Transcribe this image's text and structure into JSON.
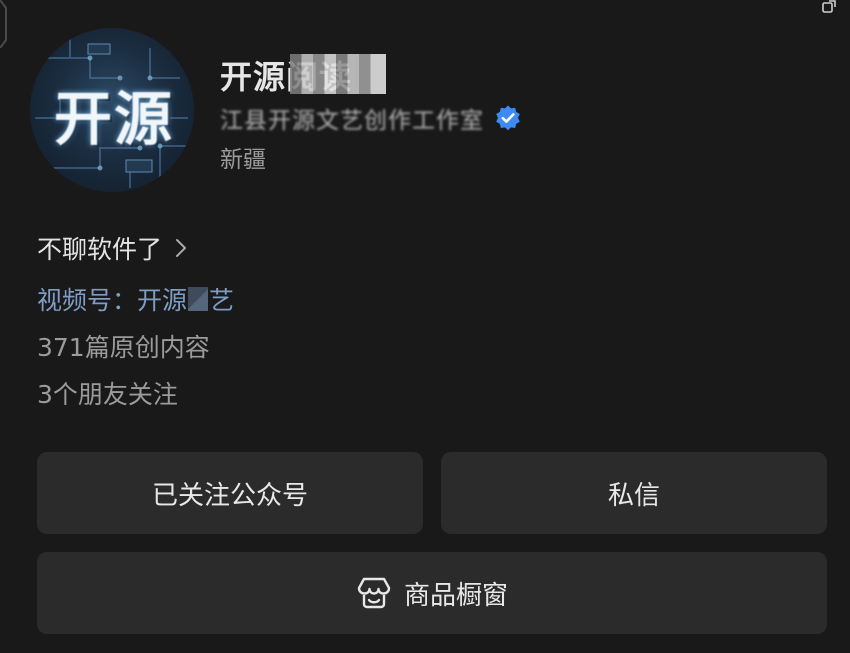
{
  "profile": {
    "name": "开源阅读",
    "verification": "江县开源文艺创作工作室",
    "region": "新疆",
    "avatar_text": "开源"
  },
  "info": {
    "signature": "不聊软件了",
    "channel_label": "视频号：",
    "channel_name_start": "开源",
    "channel_name_end": "艺",
    "articles": "371篇原创内容",
    "friends": "3个朋友关注"
  },
  "actions": {
    "follow": "已关注公众号",
    "message": "私信",
    "shop": "商品橱窗"
  },
  "colors": {
    "background": "#191919",
    "button": "#2b2b2b",
    "channel_link": "#7e9cc4",
    "verified_badge": "#3d8bf2"
  },
  "icons": {
    "verified": "verified-badge-icon",
    "chevron": "chevron-right-icon",
    "shop": "shop-icon"
  }
}
